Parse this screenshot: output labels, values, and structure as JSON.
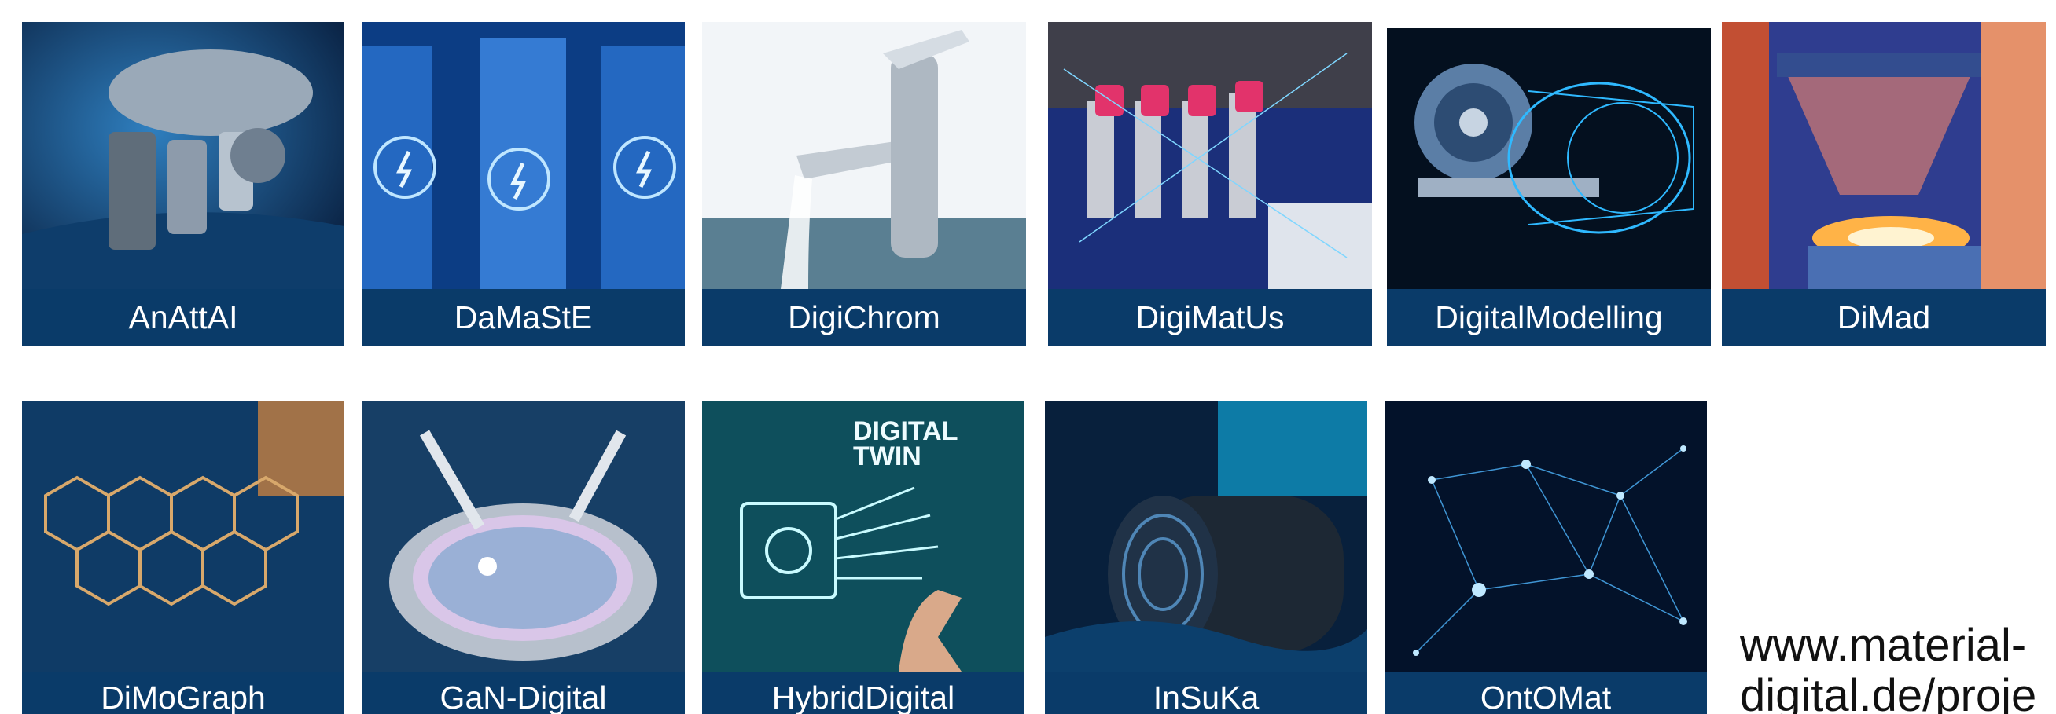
{
  "row1": [
    {
      "label": "AnAttAI",
      "theme": "microscope-photo"
    },
    {
      "label": "DaMaStE",
      "theme": "battery-cells-photo"
    },
    {
      "label": "DigiChrom",
      "theme": "chrome-faucet-photo"
    },
    {
      "label": "DigiMatUs",
      "theme": "dispensing-nozzles-photo"
    },
    {
      "label": "DigitalModelling",
      "theme": "turbine-engine-wireframe"
    },
    {
      "label": "DiMad",
      "theme": "laser-additive-nozzle-photo"
    }
  ],
  "row2": [
    {
      "label": "DiMoGraph",
      "theme": "graphene-hexagon-photo"
    },
    {
      "label": "GaN-Digital",
      "theme": "wafer-probe-photo"
    },
    {
      "label": "HybridDigital",
      "theme": "digital-twin-chip-photo",
      "overlay_text": [
        "DIGITAL",
        "TWIN"
      ]
    },
    {
      "label": "InSuKa",
      "theme": "pipe-coil-photo"
    },
    {
      "label": "OntOMat",
      "theme": "network-graph-photo"
    }
  ],
  "website": "www.material-\ndigital.de/proje",
  "colors": {
    "label_bg": "#0a3b69",
    "label_text": "#ffffff",
    "accent_blue": "#1e73c8"
  }
}
